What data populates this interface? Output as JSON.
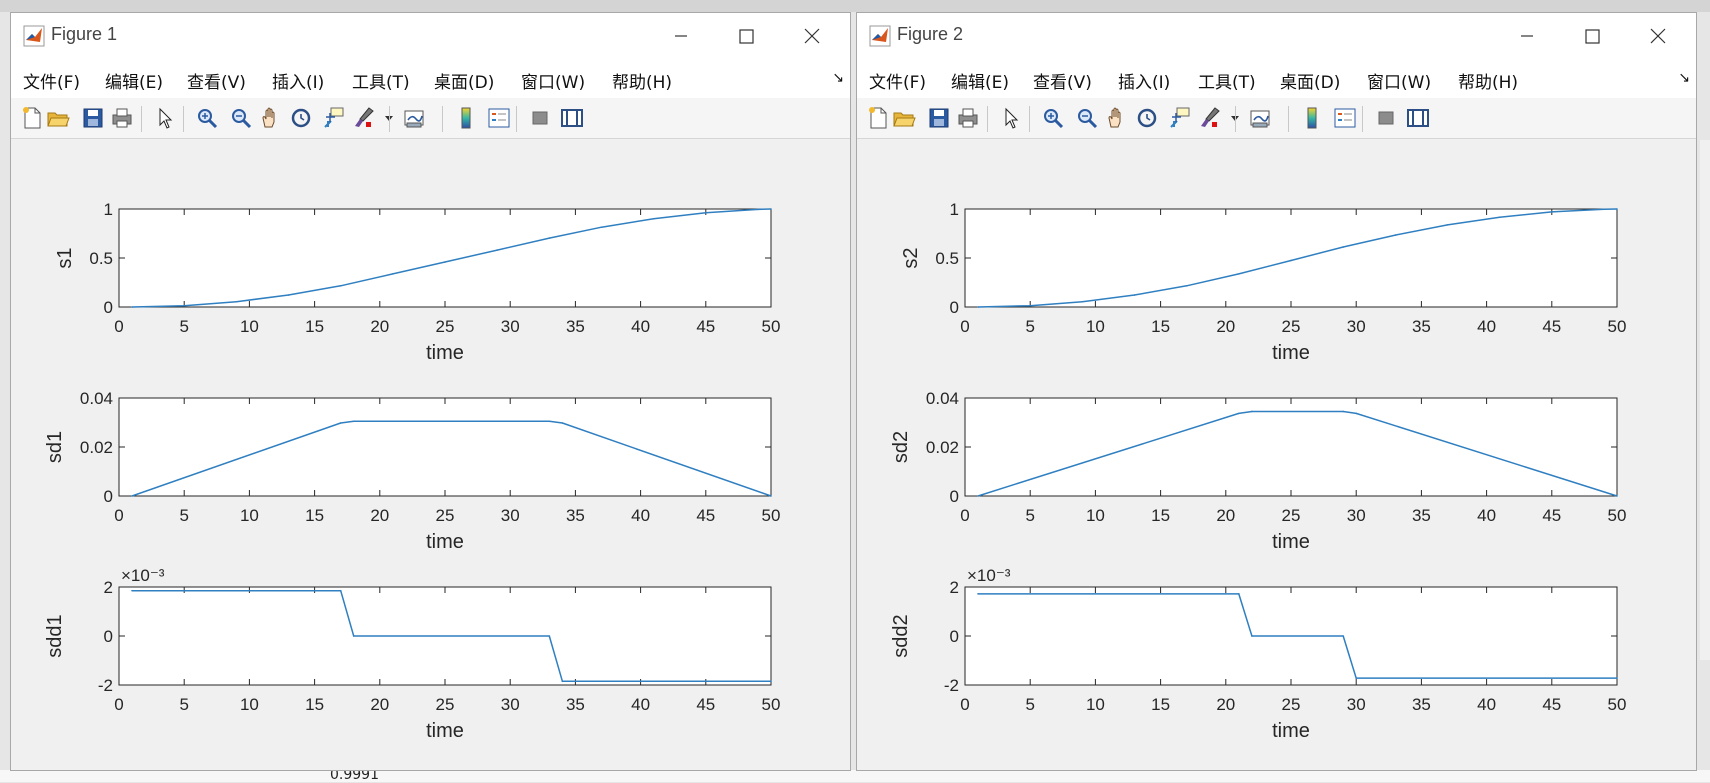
{
  "background": {
    "value_text": "0.9991"
  },
  "figures": [
    {
      "title": "Figure 1",
      "menu": [
        "文件(F)",
        "编辑(E)",
        "查看(V)",
        "插入(I)",
        "工具(T)",
        "桌面(D)",
        "窗口(W)",
        "帮助(H)"
      ],
      "chart_data": [
        {
          "type": "line",
          "xlabel": "time",
          "ylabel": "s1",
          "xlim": [
            0,
            50
          ],
          "ylim": [
            0,
            1
          ],
          "xticks": [
            "0",
            "5",
            "10",
            "15",
            "20",
            "25",
            "30",
            "35",
            "40",
            "45",
            "50"
          ],
          "yticks": [
            "0",
            "0.5",
            "1"
          ],
          "exponent": "",
          "x": [
            1,
            5,
            9,
            13,
            17,
            21,
            25,
            29,
            33,
            37,
            41,
            45,
            49,
            50
          ],
          "y": [
            0,
            0.0135,
            0.054,
            0.122,
            0.216,
            0.338,
            0.459,
            0.581,
            0.703,
            0.814,
            0.9,
            0.962,
            0.996,
            1.0
          ]
        },
        {
          "type": "line",
          "xlabel": "time",
          "ylabel": "sd1",
          "xlim": [
            0,
            50
          ],
          "ylim": [
            0,
            0.04
          ],
          "xticks": [
            "0",
            "5",
            "10",
            "15",
            "20",
            "25",
            "30",
            "35",
            "40",
            "45",
            "50"
          ],
          "yticks": [
            "0",
            "0.02",
            "0.04"
          ],
          "exponent": "",
          "x": [
            1,
            17,
            18,
            33,
            34,
            50
          ],
          "y": [
            0,
            0.0298,
            0.0305,
            0.0305,
            0.0298,
            0
          ]
        },
        {
          "type": "line",
          "xlabel": "time",
          "ylabel": "sdd1",
          "xlim": [
            0,
            50
          ],
          "ylim": [
            -2,
            2
          ],
          "xticks": [
            "0",
            "5",
            "10",
            "15",
            "20",
            "25",
            "30",
            "35",
            "40",
            "45",
            "50"
          ],
          "yticks": [
            "-2",
            "0",
            "2"
          ],
          "exponent": "×10⁻³",
          "x": [
            1,
            17,
            18,
            33,
            34,
            50
          ],
          "y": [
            1.85,
            1.85,
            0,
            0,
            -1.85,
            -1.85
          ]
        }
      ]
    },
    {
      "title": "Figure 2",
      "menu": [
        "文件(F)",
        "编辑(E)",
        "查看(V)",
        "插入(I)",
        "工具(T)",
        "桌面(D)",
        "窗口(W)",
        "帮助(H)"
      ],
      "chart_data": [
        {
          "type": "line",
          "xlabel": "time",
          "ylabel": "s2",
          "xlim": [
            0,
            50
          ],
          "ylim": [
            0,
            1
          ],
          "xticks": [
            "0",
            "5",
            "10",
            "15",
            "20",
            "25",
            "30",
            "35",
            "40",
            "45",
            "50"
          ],
          "yticks": [
            "0",
            "0.5",
            "1"
          ],
          "exponent": "",
          "x": [
            1,
            5,
            9,
            13,
            17,
            21,
            25,
            29,
            33,
            37,
            41,
            45,
            49,
            50
          ],
          "y": [
            0,
            0.0135,
            0.054,
            0.122,
            0.216,
            0.338,
            0.475,
            0.612,
            0.734,
            0.838,
            0.916,
            0.97,
            0.997,
            1.0
          ]
        },
        {
          "type": "line",
          "xlabel": "time",
          "ylabel": "sd2",
          "xlim": [
            0,
            50
          ],
          "ylim": [
            0,
            0.04
          ],
          "xticks": [
            "0",
            "5",
            "10",
            "15",
            "20",
            "25",
            "30",
            "35",
            "40",
            "45",
            "50"
          ],
          "yticks": [
            "0",
            "0.02",
            "0.04"
          ],
          "exponent": "",
          "x": [
            1,
            21,
            22,
            29,
            30,
            50
          ],
          "y": [
            0,
            0.0337,
            0.0345,
            0.0345,
            0.0337,
            0
          ]
        },
        {
          "type": "line",
          "xlabel": "time",
          "ylabel": "sdd2",
          "xlim": [
            0,
            50
          ],
          "ylim": [
            -2,
            2
          ],
          "xticks": [
            "0",
            "5",
            "10",
            "15",
            "20",
            "25",
            "30",
            "35",
            "40",
            "45",
            "50"
          ],
          "yticks": [
            "-2",
            "0",
            "2"
          ],
          "exponent": "×10⁻³",
          "x": [
            1,
            21,
            22,
            29,
            30,
            50
          ],
          "y": [
            1.72,
            1.72,
            0,
            0,
            -1.72,
            -1.72
          ]
        }
      ]
    }
  ],
  "colors": {
    "line": "#2f7fc1",
    "axes": "#262626",
    "grid_bg": "#ffffff",
    "window_bg": "#f0f0f0"
  },
  "toolbar_icons": [
    "new-file-icon",
    "open-folder-icon",
    "save-icon",
    "print-icon",
    "pointer-icon",
    "zoom-in-icon",
    "zoom-out-icon",
    "pan-hand-icon",
    "rotate-3d-icon",
    "data-cursor-icon",
    "brush-icon",
    "brush-dropdown-icon",
    "link-plot-icon",
    "colorbar-icon",
    "legend-icon",
    "hide-plot-tools-icon",
    "show-plot-tools-icon"
  ]
}
